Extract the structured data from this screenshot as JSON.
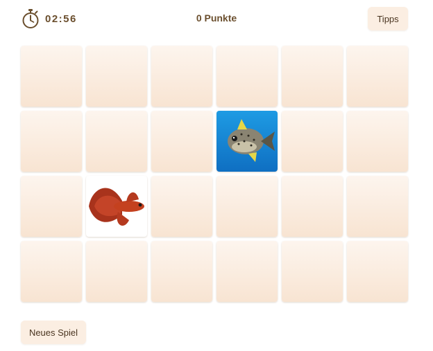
{
  "timer": {
    "value": "02:56",
    "icon": "stopwatch-icon"
  },
  "score": {
    "label": "0 Punkte"
  },
  "buttons": {
    "tips": "Tipps",
    "new_game": "Neues Spiel"
  },
  "board": {
    "rows": 4,
    "cols": 6,
    "cards": [
      {
        "state": "hidden"
      },
      {
        "state": "hidden"
      },
      {
        "state": "hidden"
      },
      {
        "state": "hidden"
      },
      {
        "state": "hidden"
      },
      {
        "state": "hidden"
      },
      {
        "state": "hidden"
      },
      {
        "state": "hidden"
      },
      {
        "state": "hidden"
      },
      {
        "state": "revealed",
        "image": "pufferfish"
      },
      {
        "state": "hidden"
      },
      {
        "state": "hidden"
      },
      {
        "state": "hidden"
      },
      {
        "state": "revealed",
        "image": "betta-fish"
      },
      {
        "state": "hidden"
      },
      {
        "state": "hidden"
      },
      {
        "state": "hidden"
      },
      {
        "state": "hidden"
      },
      {
        "state": "hidden"
      },
      {
        "state": "hidden"
      },
      {
        "state": "hidden"
      },
      {
        "state": "hidden"
      },
      {
        "state": "hidden"
      },
      {
        "state": "hidden"
      }
    ]
  },
  "colors": {
    "text": "#6b4f2e",
    "card_back_top": "#fdf5ee",
    "card_back_bottom": "#f8e4d2",
    "button_bg": "#fbeee2"
  }
}
